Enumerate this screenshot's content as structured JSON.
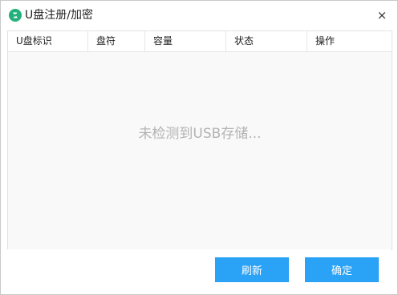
{
  "window": {
    "title": "U盘注册/加密",
    "close_label": "×"
  },
  "table": {
    "columns": [
      "U盘标识",
      "盘符",
      "容量",
      "状态",
      "操作"
    ],
    "rows": [],
    "empty_text": "未检测到USB存储..."
  },
  "buttons": {
    "refresh_label": "刷新",
    "confirm_label": "确定"
  },
  "colors": {
    "accent": "#2aa2f5",
    "app_icon": "#22b07d"
  }
}
